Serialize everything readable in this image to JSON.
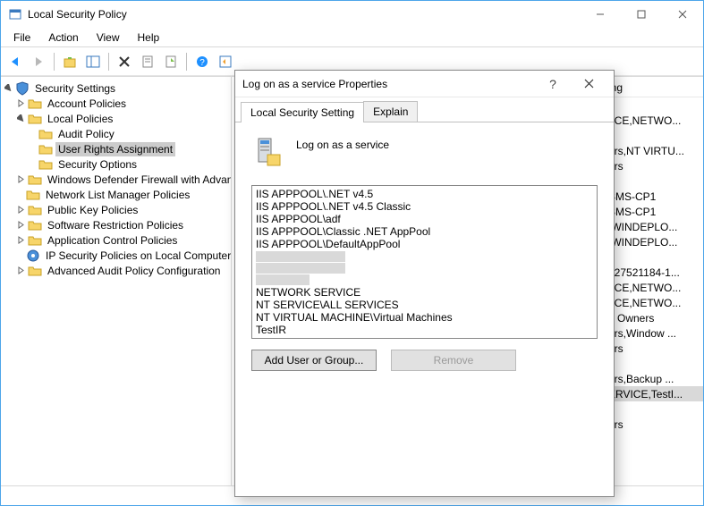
{
  "window": {
    "title": "Local Security Policy"
  },
  "menu": {
    "file": "File",
    "action": "Action",
    "view": "View",
    "help": "Help"
  },
  "tree": {
    "root": "Security Settings",
    "account_policies": "Account Policies",
    "local_policies": "Local Policies",
    "audit_policy": "Audit Policy",
    "user_rights": "User Rights Assignment",
    "security_options": "Security Options",
    "firewall": "Windows Defender Firewall with Advanced Security",
    "netlist": "Network List Manager Policies",
    "pubkey": "Public Key Policies",
    "softrestrict": "Software Restriction Policies",
    "appcontrol": "Application Control Policies",
    "ipsec": "IP Security Policies on Local Computer",
    "advaudit": "Advanced Audit Policy Configuration"
  },
  "right_col_header": "ing",
  "right_rows": [
    "",
    "/ICE,NETWO...",
    "",
    "ors,NT VIRTU...",
    "ors",
    "",
    "SMS-CP1",
    "SMS-CP1",
    "\\WINDEPLO...",
    "\\WINDEPLO...",
    "",
    "127521184-1...",
    "/ICE,NETWO...",
    "/ICE,NETWO...",
    "e Owners",
    "ors,Window ...",
    "ors",
    "",
    "ors,Backup ...",
    "ERVICE,TestI...",
    "",
    "ors"
  ],
  "dialog": {
    "title": "Log on as a service Properties",
    "tab_local": "Local Security Setting",
    "tab_explain": "Explain",
    "policy_name": "Log on as a service",
    "entries": [
      "IIS APPPOOL\\.NET v4.5",
      "IIS APPPOOL\\.NET v4.5 Classic",
      "IIS APPPOOL\\adf",
      "IIS APPPOOL\\Classic .NET AppPool",
      "IIS APPPOOL\\DefaultAppPool",
      "NETWORK SERVICE",
      "NT SERVICE\\ALL SERVICES",
      "NT VIRTUAL MACHINE\\Virtual Machines",
      "TestIR"
    ],
    "add_btn": "Add User or Group...",
    "remove_btn": "Remove"
  }
}
